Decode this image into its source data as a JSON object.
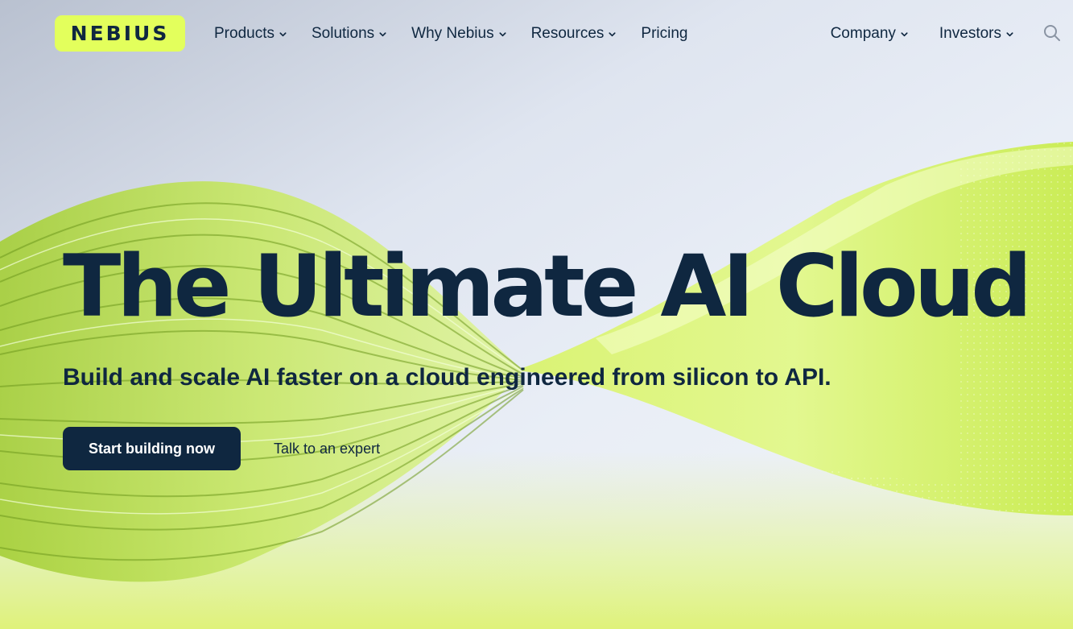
{
  "brand": {
    "logo_text": "NEBIUS",
    "accent_color": "#e3ff5c",
    "dark_color": "#0f2740"
  },
  "nav": {
    "left_items": [
      {
        "label": "Products",
        "has_dropdown": true
      },
      {
        "label": "Solutions",
        "has_dropdown": true
      },
      {
        "label": "Why Nebius",
        "has_dropdown": true
      },
      {
        "label": "Resources",
        "has_dropdown": true
      },
      {
        "label": "Pricing",
        "has_dropdown": false
      }
    ],
    "right_items": [
      {
        "label": "Company",
        "has_dropdown": true
      },
      {
        "label": "Investors",
        "has_dropdown": true
      }
    ],
    "search_icon": "search-icon"
  },
  "hero": {
    "title": "The Ultimate AI Cloud",
    "subtitle": "Build and scale AI faster on a cloud engineered from silicon to API.",
    "primary_cta": "Start building now",
    "secondary_cta": "Talk to an expert"
  }
}
